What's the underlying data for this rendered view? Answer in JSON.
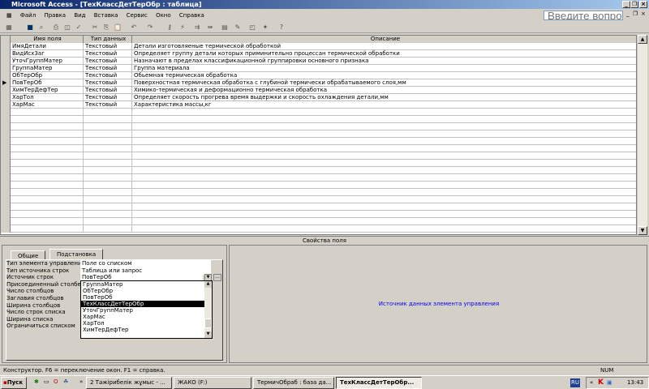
{
  "window": {
    "title": "Microsoft Access - [ТехКлассДетТерОбр : таблица]"
  },
  "menu": {
    "items": [
      "Файл",
      "Правка",
      "Вид",
      "Вставка",
      "Сервис",
      "Окно",
      "Справка"
    ],
    "ask_placeholder": "Введите вопрос"
  },
  "table": {
    "headers": [
      "Имя поля",
      "Тип данных",
      "Описание"
    ],
    "rows": [
      {
        "name": "ИмяДетали",
        "type": "Текстовый",
        "desc": "Детали изготовляеные термической обработкой"
      },
      {
        "name": "ВидИсхЗаг",
        "type": "Текстовый",
        "desc": "Определяет группу детали которых приминительно процессан термической обработки"
      },
      {
        "name": "УточГруппМатер",
        "type": "Текстовый",
        "desc": "Назначают в пределах классификационной группировки основного признака"
      },
      {
        "name": "ГруппаМатер",
        "type": "Текстовый",
        "desc": "Группа материала"
      },
      {
        "name": "ОбТерОбр",
        "type": "Текстовый",
        "desc": "Обьемная термическая обработка"
      },
      {
        "name": "ПовТерОб",
        "type": "Текстовый",
        "desc": "Поверхностная термическая обработка с глубиной термически обрабатываемого слоя,мм",
        "current": true
      },
      {
        "name": "ХимТерДефТер",
        "type": "Текстовый",
        "desc": "Химико-термическая и деформационно термическая обработка"
      },
      {
        "name": "ХарТол",
        "type": "Текстовый",
        "desc": "Определяет скорость прогрева время выдержки и скорость охлаждения детали,мм"
      },
      {
        "name": "ХарМас",
        "type": "Текстовый",
        "desc": "Характеристика массы,кг"
      }
    ]
  },
  "properties": {
    "title": "Свойства поля",
    "tabs": [
      "Общие",
      "Подстановка"
    ],
    "labels": [
      "Тип элемента управления",
      "Тип источника строк",
      "Источник строк",
      "Присоединенный столбец",
      "Число столбцов",
      "Заглавия столбцов",
      "Ширина столбцов",
      "Число строк списка",
      "Ширина списка",
      "Ограничиться списком"
    ],
    "values": [
      "Поле со списком",
      "Таблица или запрос",
      "ПовТерОб"
    ],
    "dropdown": [
      "ГруппаМатер",
      "ОбТерОбр",
      "ПовТерОб",
      "ТехКлассДетТерОбр",
      "УточГруппМатер",
      "ХарМас",
      "ХарТол",
      "ХимТерДефТер"
    ],
    "hint": "Источник данных элемента управления"
  },
  "status": {
    "text": "Конструктор.  F6 = переключение окон.  F1 = справка.",
    "num": "NUM"
  },
  "taskbar": {
    "start": "Пуск",
    "tasks": [
      "2 Тәжірибелік жұмыс - ...",
      "ЖАКО (F:)",
      "ТермичОбраб : база да...",
      "ТехКлассДетТерОбр..."
    ],
    "lang": "RU",
    "clock": "13:43"
  }
}
